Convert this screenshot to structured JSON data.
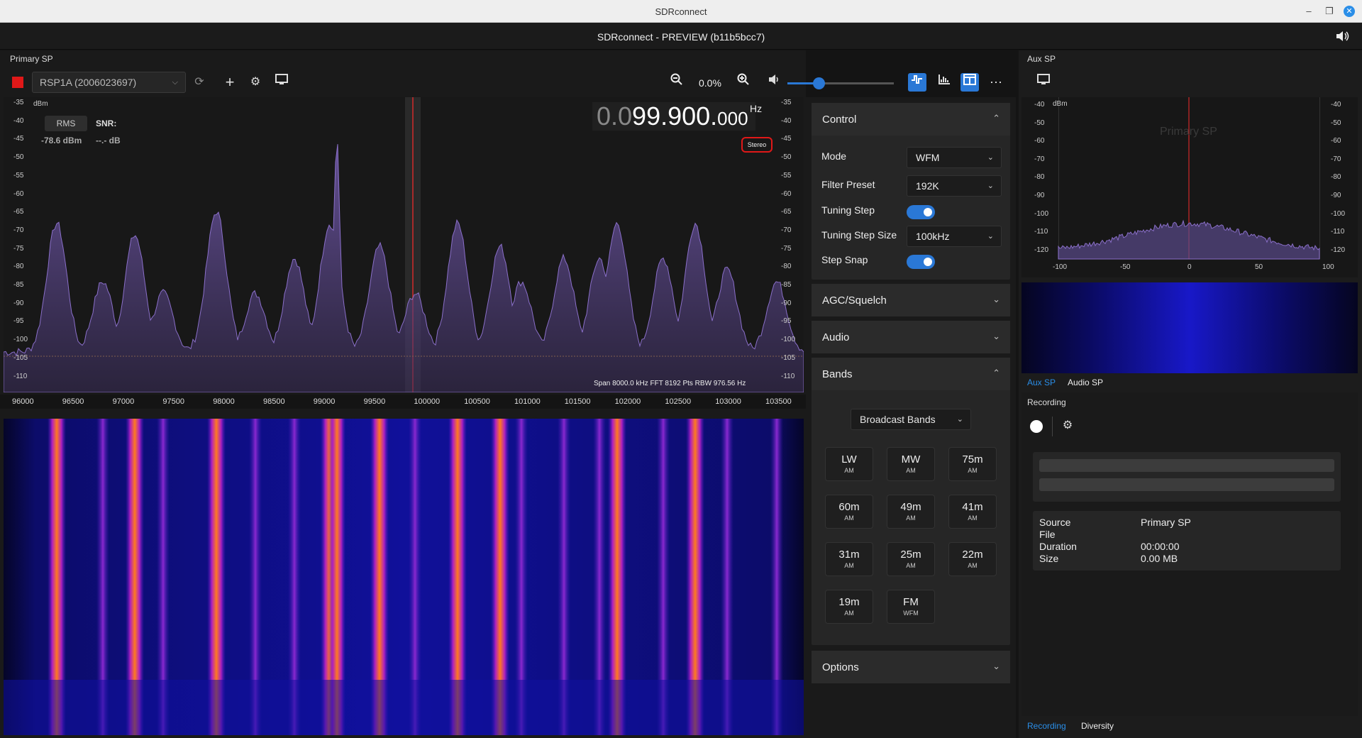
{
  "os": {
    "title": "SDRconnect",
    "minimize": "–",
    "maximize": "❐",
    "close": "✕"
  },
  "app": {
    "title": "SDRconnect - PREVIEW (b11b5bcc7)",
    "speaker_icon": "speaker-icon"
  },
  "primary": {
    "label": "Primary SP",
    "device": "RSP1A (2006023697)",
    "zoom": "0.0%",
    "frequency": {
      "dim": "0.0",
      "main": "99.900.",
      "sub": "000",
      "unit": "Hz"
    },
    "stereo": "Stereo",
    "rms_btn": "RMS",
    "snr_label": "SNR:",
    "rms_value": "-78.6 dBm",
    "snr_value": "--.- dB",
    "dbm": "dBm",
    "span_info": "Span 8000.0 kHz FFT 8192 Pts  RBW 976.56 Hz",
    "y_ticks": [
      "-35",
      "-40",
      "-45",
      "-50",
      "-55",
      "-60",
      "-65",
      "-70",
      "-75",
      "-80",
      "-85",
      "-90",
      "-95",
      "-100",
      "-105",
      "-110"
    ],
    "x_ticks": [
      "96000",
      "96500",
      "97000",
      "97500",
      "98000",
      "98500",
      "99000",
      "99500",
      "100000",
      "100500",
      "101000",
      "101500",
      "102000",
      "102500",
      "103000",
      "103500"
    ]
  },
  "control": {
    "title": "Control",
    "mode_label": "Mode",
    "mode_value": "WFM",
    "filter_label": "Filter Preset",
    "filter_value": "192K",
    "tuning_step_label": "Tuning Step",
    "tuning_step_size_label": "Tuning Step Size",
    "tuning_step_size_value": "100kHz",
    "step_snap_label": "Step Snap"
  },
  "sections": {
    "agc": "AGC/Squelch",
    "audio": "Audio",
    "bands": "Bands",
    "options": "Options"
  },
  "bands": {
    "selector": "Broadcast Bands",
    "items": [
      {
        "name": "LW",
        "mode": "AM"
      },
      {
        "name": "MW",
        "mode": "AM"
      },
      {
        "name": "75m",
        "mode": "AM"
      },
      {
        "name": "60m",
        "mode": "AM"
      },
      {
        "name": "49m",
        "mode": "AM"
      },
      {
        "name": "41m",
        "mode": "AM"
      },
      {
        "name": "31m",
        "mode": "AM"
      },
      {
        "name": "25m",
        "mode": "AM"
      },
      {
        "name": "22m",
        "mode": "AM"
      },
      {
        "name": "19m",
        "mode": "AM"
      },
      {
        "name": "FM",
        "mode": "WFM"
      }
    ]
  },
  "aux": {
    "label": "Aux SP",
    "dbm": "dBm",
    "watermark": "Primary SP",
    "y_ticks": [
      "-40",
      "-50",
      "-60",
      "-70",
      "-80",
      "-90",
      "-100",
      "-110",
      "-120"
    ],
    "x_ticks": [
      "-100",
      "-50",
      "0",
      "50",
      "100"
    ],
    "tab_aux": "Aux SP",
    "tab_audio": "Audio SP"
  },
  "recording": {
    "title": "Recording",
    "source_label": "Source",
    "source_value": "Primary SP",
    "file_label": "File",
    "file_value": "",
    "duration_label": "Duration",
    "duration_value": "00:00:00",
    "size_label": "Size",
    "size_value": "0.00 MB",
    "tab_recording": "Recording",
    "tab_diversity": "Diversity"
  },
  "colors": {
    "accent": "#2a78d6",
    "trace": "#8a6fc9",
    "stop": "#e01818"
  }
}
